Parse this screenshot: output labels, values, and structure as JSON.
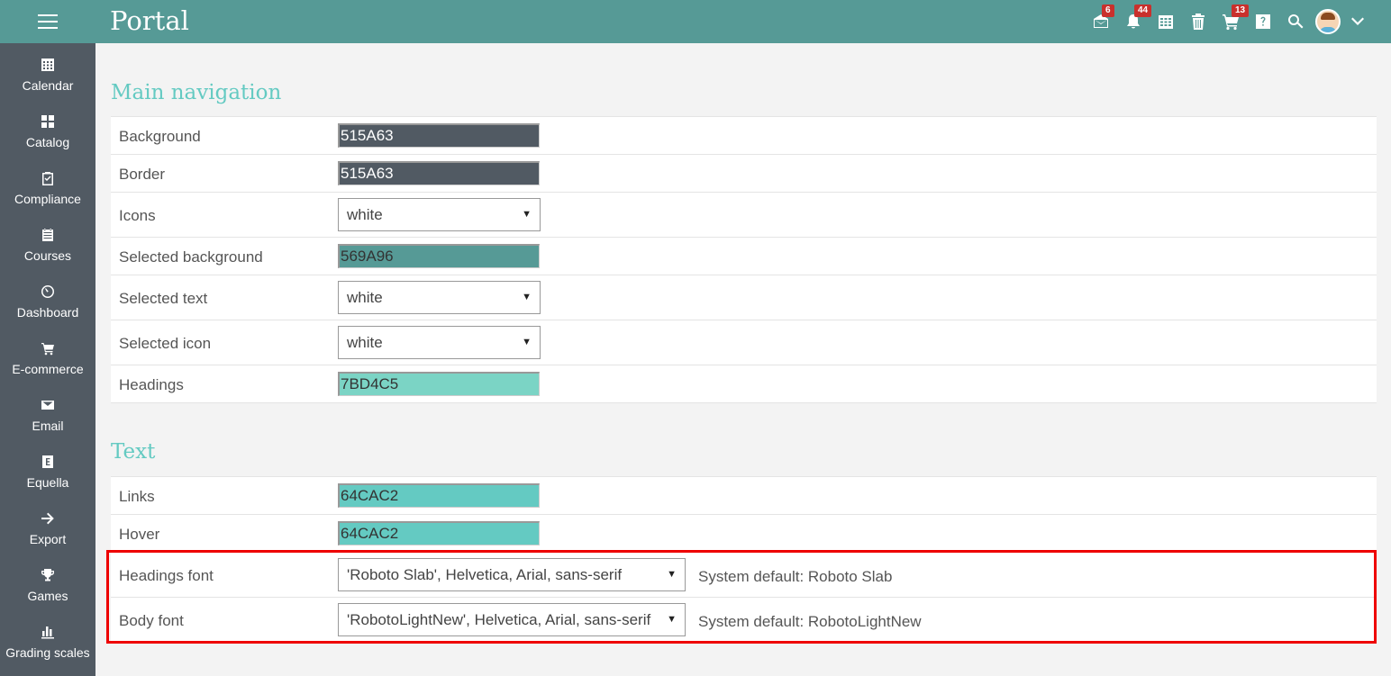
{
  "app": {
    "title": "Portal"
  },
  "topbar": {
    "icons": [
      {
        "name": "inbox-icon",
        "badge": "6"
      },
      {
        "name": "bell-icon",
        "badge": "44"
      },
      {
        "name": "calendar-icon",
        "badge": ""
      },
      {
        "name": "trash-icon",
        "badge": ""
      },
      {
        "name": "cart-icon",
        "badge": "13"
      },
      {
        "name": "help-icon",
        "badge": ""
      },
      {
        "name": "search-icon",
        "badge": ""
      }
    ]
  },
  "sidebar": {
    "items": [
      {
        "label": "Calendar",
        "icon": "calendar-icon"
      },
      {
        "label": "Catalog",
        "icon": "grid-icon"
      },
      {
        "label": "Compliance",
        "icon": "clipboard-check-icon"
      },
      {
        "label": "Courses",
        "icon": "courses-icon"
      },
      {
        "label": "Dashboard",
        "icon": "gauge-icon"
      },
      {
        "label": "E-commerce",
        "icon": "cart-icon"
      },
      {
        "label": "Email",
        "icon": "envelope-icon"
      },
      {
        "label": "Equella",
        "icon": "equella-icon"
      },
      {
        "label": "Export",
        "icon": "arrow-right-icon"
      },
      {
        "label": "Games",
        "icon": "trophy-icon"
      },
      {
        "label": "Grading scales",
        "icon": "bar-chart-icon"
      }
    ]
  },
  "main_navigation": {
    "title": "Main navigation",
    "rows": [
      {
        "label": "Background",
        "type": "color",
        "value": "515A63",
        "color": "#515A63",
        "text_color": "#ffffff"
      },
      {
        "label": "Border",
        "type": "color",
        "value": "515A63",
        "color": "#515A63",
        "text_color": "#ffffff"
      },
      {
        "label": "Icons",
        "type": "select",
        "value": "white"
      },
      {
        "label": "Selected background",
        "type": "color",
        "value": "569A96",
        "color": "#569A96",
        "text_color": "#333333"
      },
      {
        "label": "Selected text",
        "type": "select",
        "value": "white"
      },
      {
        "label": "Selected icon",
        "type": "select",
        "value": "white"
      },
      {
        "label": "Headings",
        "type": "color",
        "value": "7BD4C5",
        "color": "#7BD4C5",
        "text_color": "#333333"
      }
    ]
  },
  "text": {
    "title": "Text",
    "rows": [
      {
        "label": "Links",
        "type": "color",
        "value": "64CAC2",
        "color": "#64CAC2",
        "text_color": "#333333"
      },
      {
        "label": "Hover",
        "type": "color",
        "value": "64CAC2",
        "color": "#64CAC2",
        "text_color": "#333333"
      },
      {
        "label": "Headings font",
        "type": "font",
        "value": "'Roboto Slab', Helvetica, Arial, sans-serif",
        "system_default": "System default: Roboto Slab"
      },
      {
        "label": "Body font",
        "type": "font",
        "value": "'RobotoLightNew', Helvetica, Arial, sans-serif",
        "system_default": "System default: RobotoLightNew"
      }
    ]
  },
  "colors": {
    "topbar": "#569a96",
    "sidebar": "#515a63",
    "heading": "#64cac2",
    "highlight": "#ee0000"
  }
}
